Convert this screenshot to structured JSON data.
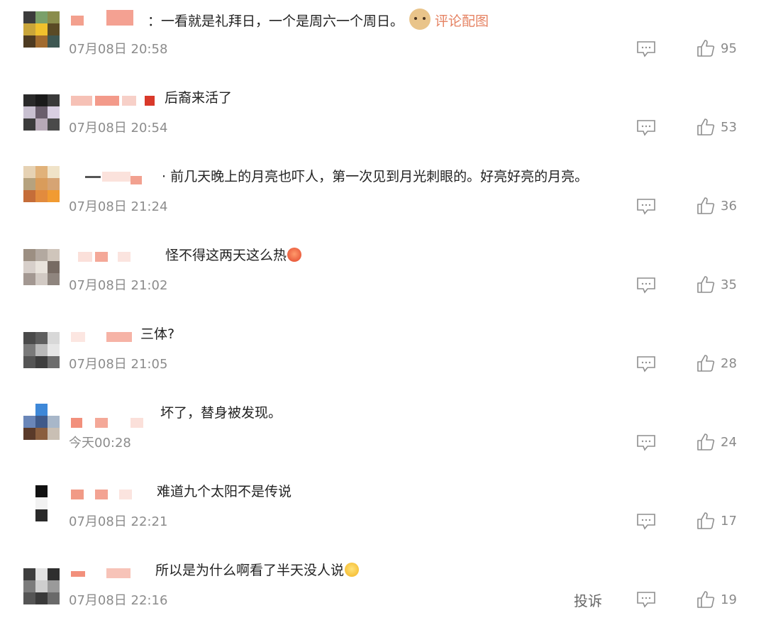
{
  "comments": [
    {
      "text": "：一看就是礼拜日，一个是周六一个周日。",
      "link": "评论配图",
      "time": "07月08日 20:58",
      "likes": "95"
    },
    {
      "text": "后裔来活了",
      "time": "07月08日 20:54",
      "likes": "53"
    },
    {
      "text": "· 前几天晚上的月亮也吓人，第一次见到月光刺眼的。好亮好亮的月亮。",
      "time": "07月08日 21:24",
      "likes": "36"
    },
    {
      "text": "怪不得这两天这么热",
      "time": "07月08日 21:02",
      "likes": "35"
    },
    {
      "text": "三体?",
      "time": "07月08日 21:05",
      "likes": "28"
    },
    {
      "text": "坏了，替身被发现。",
      "time": "今天00:28",
      "likes": "24"
    },
    {
      "text": "难道九个太阳不是传说",
      "time": "07月08日 22:21",
      "likes": "17"
    },
    {
      "text": "所以是为什么啊看了半天没人说",
      "time": "07月08日 22:16",
      "likes": "19"
    }
  ],
  "report_label": "投诉",
  "icons": {
    "reply": "comment-bubble-icon",
    "like": "thumbs-up-icon",
    "doge": "doge-emoji-icon",
    "hot": "hot-face-emoji-icon",
    "cry": "crying-laughing-emoji-icon"
  },
  "colors": {
    "accent_link": "#e58262",
    "time_gray": "#8c8c8c"
  }
}
